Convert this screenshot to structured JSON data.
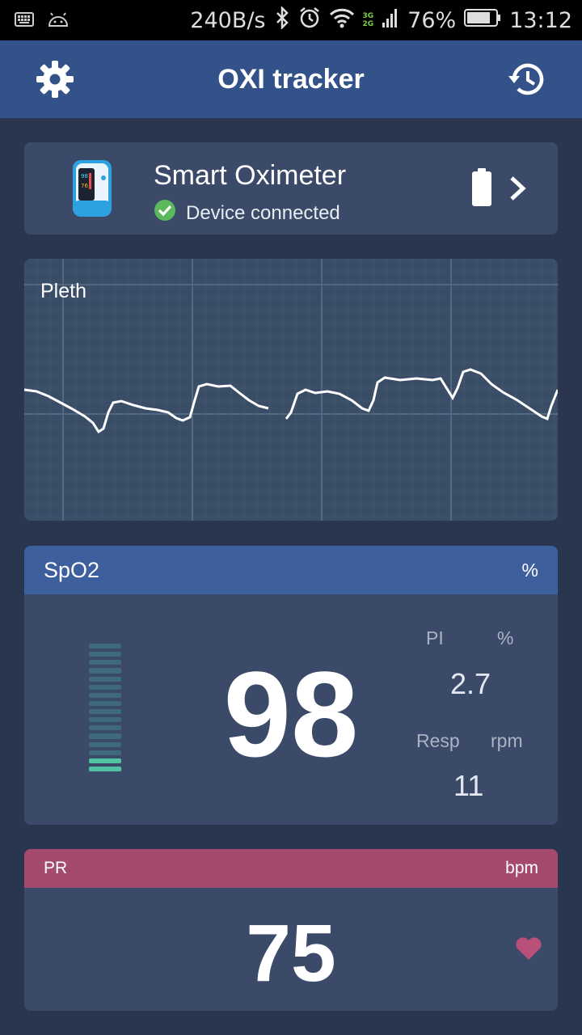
{
  "status_bar": {
    "net_speed": "240B/s",
    "network_types": [
      "3G",
      "2G"
    ],
    "battery": "76%",
    "time": "13:12",
    "icons": [
      "keyboard-icon",
      "android-icon",
      "bluetooth-icon",
      "alarm-icon",
      "wifi-icon",
      "signal-icon",
      "battery-icon"
    ]
  },
  "app_bar": {
    "title": "OXI tracker",
    "left_icon": "settings-gear-icon",
    "right_icon": "history-icon"
  },
  "device": {
    "name": "Smart Oximeter",
    "status": "Device connected",
    "battery_icon": "battery-full-icon",
    "chevron_icon": "chevron-right-icon"
  },
  "pleth": {
    "label": "Pleth"
  },
  "spo2": {
    "label": "SpO2",
    "unit": "%",
    "value": "98",
    "pi_label": "PI",
    "pi_unit": "%",
    "pi_value": "2.7",
    "resp_label": "Resp",
    "resp_unit": "rpm",
    "resp_value": "11",
    "bar_segments": 16,
    "bar_active_segments": 2
  },
  "pr": {
    "label": "PR",
    "unit": "bpm",
    "value": "75",
    "icon": "heart-icon"
  },
  "colors": {
    "background": "#2a3550",
    "app_bar": "#33528a",
    "card": "#3b4a68",
    "spo2_header": "#3e5f9e",
    "pr_header": "#a44a6e",
    "connected_green": "#5cb85c",
    "bar_active": "#4fc3a0",
    "heart": "#b8507a"
  }
}
